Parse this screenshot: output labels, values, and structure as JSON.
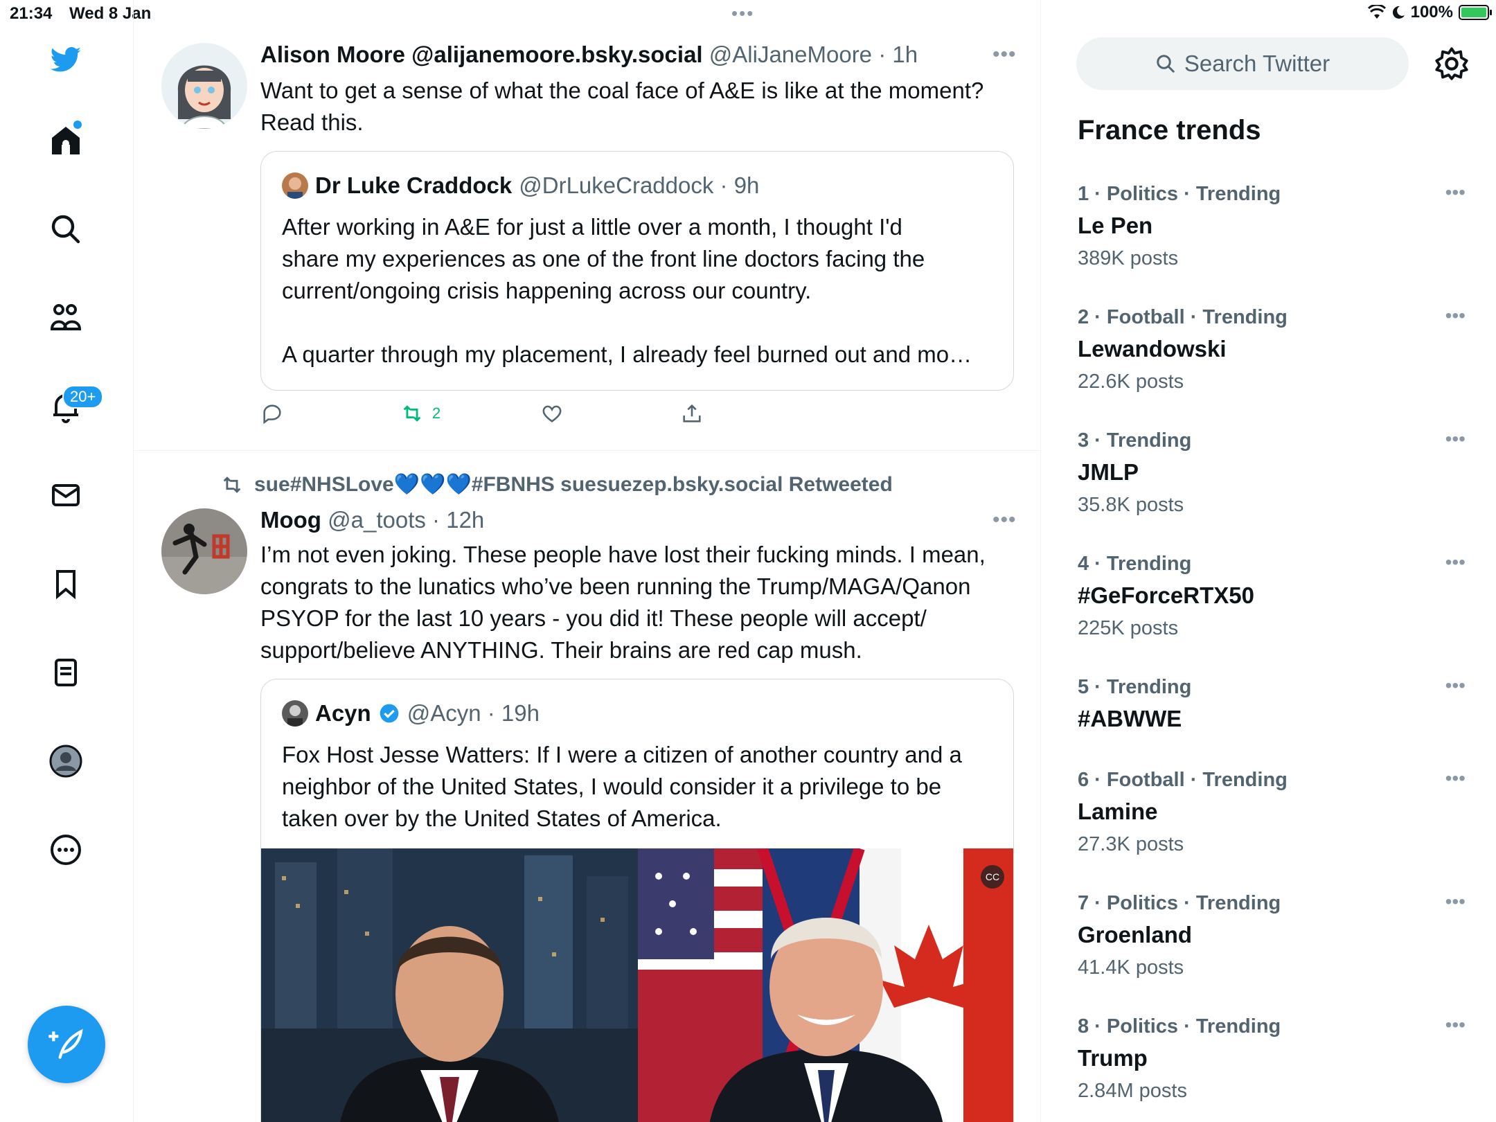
{
  "status_bar": {
    "time": "21:34",
    "date": "Wed 8 Jan",
    "battery": "100%"
  },
  "nav": {
    "notifications_badge": "20+"
  },
  "tweets": [
    {
      "name": "Alison Moore @alijanemoore.bsky.social",
      "handle_time": "@AliJaneMoore · 1h",
      "text": "Want to get a sense of what the coal face of A&E is like at the moment?\nRead this.",
      "quote": {
        "name": "Dr Luke Craddock",
        "handle_time": "@DrLukeCraddock · 9h",
        "text": "After working in A&E for just a little over a month, I thought I'd\nshare my experiences as one of the front line doctors facing the\ncurrent/ongoing crisis happening across our country.\n\nA quarter through my placement, I already feel burned out and mo…"
      },
      "retweet_count": "2"
    },
    {
      "retweeted_by": "sue#NHSLove💙💙💙#FBNHS suesuezep.bsky.social Retweeted",
      "name": "Moog",
      "handle_time": "@a_toots · 12h",
      "text": "I’m not even joking. These people have lost their fucking minds. I mean,\ncongrats to the lunatics who’ve been running the Trump/MAGA/Qanon\nPSYOP for the last 10 years - you did it! These people will accept/\nsupport/believe ANYTHING. Their brains are red cap mush.",
      "quote": {
        "name": "Acyn",
        "handle_time": "@Acyn · 19h",
        "text": "Fox Host Jesse Watters: If I were a citizen of another country and a\nneighbor of the United States, I would consider it a privilege to be\ntaken over by the United States of America."
      }
    }
  ],
  "sidebar": {
    "search_placeholder": "Search Twitter",
    "trends_title": "France trends",
    "trends": [
      {
        "context": "1 · Politics · Trending",
        "topic": "Le Pen",
        "count": "389K posts"
      },
      {
        "context": "2 · Football · Trending",
        "topic": "Lewandowski",
        "count": "22.6K posts"
      },
      {
        "context": "3 · Trending",
        "topic": "JMLP",
        "count": "35.8K posts"
      },
      {
        "context": "4 · Trending",
        "topic": "#GeForceRTX50",
        "count": "225K posts"
      },
      {
        "context": "5 · Trending",
        "topic": "#ABWWE",
        "count": ""
      },
      {
        "context": "6 · Football · Trending",
        "topic": "Lamine",
        "count": "27.3K posts"
      },
      {
        "context": "7 · Politics · Trending",
        "topic": "Groenland",
        "count": "41.4K posts"
      },
      {
        "context": "8 · Politics · Trending",
        "topic": "Trump",
        "count": "2.84M posts"
      }
    ]
  },
  "colors": {
    "accent": "#1d9bf0",
    "retweet_green": "#00ba7c",
    "secondary_text": "#536471"
  }
}
